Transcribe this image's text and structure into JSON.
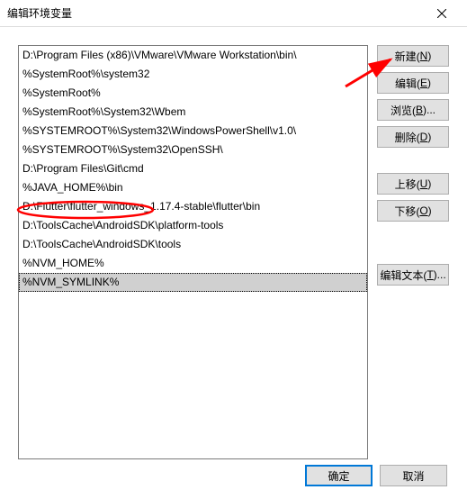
{
  "title": "编辑环境变量",
  "list": {
    "items": [
      "D:\\Program Files (x86)\\VMware\\VMware Workstation\\bin\\",
      "%SystemRoot%\\system32",
      "%SystemRoot%",
      "%SystemRoot%\\System32\\Wbem",
      "%SYSTEMROOT%\\System32\\WindowsPowerShell\\v1.0\\",
      "%SYSTEMROOT%\\System32\\OpenSSH\\",
      "D:\\Program Files\\Git\\cmd",
      "%JAVA_HOME%\\bin",
      "D:\\Flutter\\flutter_windows_1.17.4-stable\\flutter\\bin",
      "D:\\ToolsCache\\AndroidSDK\\platform-tools",
      "D:\\ToolsCache\\AndroidSDK\\tools",
      "%NVM_HOME%",
      "%NVM_SYMLINK%"
    ],
    "selected_index": 12
  },
  "buttons": {
    "new_prefix": "新建(",
    "new_key": "N",
    "new_suffix": ")",
    "edit_prefix": "编辑(",
    "edit_key": "E",
    "edit_suffix": ")",
    "browse_prefix": "浏览(",
    "browse_key": "B",
    "browse_suffix": ")...",
    "delete_prefix": "删除(",
    "delete_key": "D",
    "delete_suffix": ")",
    "moveup_prefix": "上移(",
    "moveup_key": "U",
    "moveup_suffix": ")",
    "movedown_prefix": "下移(",
    "movedown_key": "O",
    "movedown_suffix": ")",
    "edittext_prefix": "编辑文本(",
    "edittext_key": "T",
    "edittext_suffix": ")..."
  },
  "bottom": {
    "ok": "确定",
    "cancel": "取消"
  },
  "annotations": {
    "arrow_color": "#ff0000",
    "circle_color": "#ff0000"
  }
}
